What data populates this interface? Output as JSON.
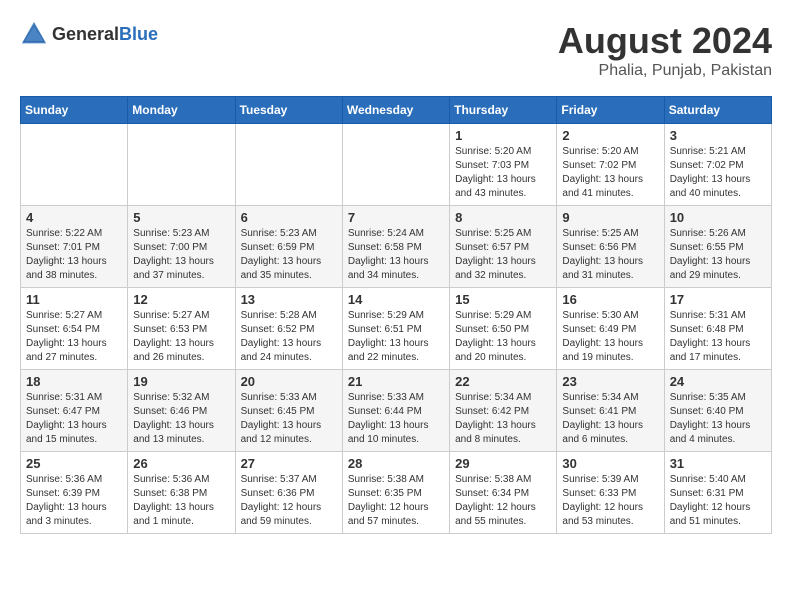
{
  "header": {
    "logo": {
      "general": "General",
      "blue": "Blue"
    },
    "title": "August 2024",
    "location": "Phalia, Punjab, Pakistan"
  },
  "calendar": {
    "weekdays": [
      "Sunday",
      "Monday",
      "Tuesday",
      "Wednesday",
      "Thursday",
      "Friday",
      "Saturday"
    ],
    "weeks": [
      [
        {
          "day": "",
          "info": ""
        },
        {
          "day": "",
          "info": ""
        },
        {
          "day": "",
          "info": ""
        },
        {
          "day": "",
          "info": ""
        },
        {
          "day": "1",
          "info": "Sunrise: 5:20 AM\nSunset: 7:03 PM\nDaylight: 13 hours\nand 43 minutes."
        },
        {
          "day": "2",
          "info": "Sunrise: 5:20 AM\nSunset: 7:02 PM\nDaylight: 13 hours\nand 41 minutes."
        },
        {
          "day": "3",
          "info": "Sunrise: 5:21 AM\nSunset: 7:02 PM\nDaylight: 13 hours\nand 40 minutes."
        }
      ],
      [
        {
          "day": "4",
          "info": "Sunrise: 5:22 AM\nSunset: 7:01 PM\nDaylight: 13 hours\nand 38 minutes."
        },
        {
          "day": "5",
          "info": "Sunrise: 5:23 AM\nSunset: 7:00 PM\nDaylight: 13 hours\nand 37 minutes."
        },
        {
          "day": "6",
          "info": "Sunrise: 5:23 AM\nSunset: 6:59 PM\nDaylight: 13 hours\nand 35 minutes."
        },
        {
          "day": "7",
          "info": "Sunrise: 5:24 AM\nSunset: 6:58 PM\nDaylight: 13 hours\nand 34 minutes."
        },
        {
          "day": "8",
          "info": "Sunrise: 5:25 AM\nSunset: 6:57 PM\nDaylight: 13 hours\nand 32 minutes."
        },
        {
          "day": "9",
          "info": "Sunrise: 5:25 AM\nSunset: 6:56 PM\nDaylight: 13 hours\nand 31 minutes."
        },
        {
          "day": "10",
          "info": "Sunrise: 5:26 AM\nSunset: 6:55 PM\nDaylight: 13 hours\nand 29 minutes."
        }
      ],
      [
        {
          "day": "11",
          "info": "Sunrise: 5:27 AM\nSunset: 6:54 PM\nDaylight: 13 hours\nand 27 minutes."
        },
        {
          "day": "12",
          "info": "Sunrise: 5:27 AM\nSunset: 6:53 PM\nDaylight: 13 hours\nand 26 minutes."
        },
        {
          "day": "13",
          "info": "Sunrise: 5:28 AM\nSunset: 6:52 PM\nDaylight: 13 hours\nand 24 minutes."
        },
        {
          "day": "14",
          "info": "Sunrise: 5:29 AM\nSunset: 6:51 PM\nDaylight: 13 hours\nand 22 minutes."
        },
        {
          "day": "15",
          "info": "Sunrise: 5:29 AM\nSunset: 6:50 PM\nDaylight: 13 hours\nand 20 minutes."
        },
        {
          "day": "16",
          "info": "Sunrise: 5:30 AM\nSunset: 6:49 PM\nDaylight: 13 hours\nand 19 minutes."
        },
        {
          "day": "17",
          "info": "Sunrise: 5:31 AM\nSunset: 6:48 PM\nDaylight: 13 hours\nand 17 minutes."
        }
      ],
      [
        {
          "day": "18",
          "info": "Sunrise: 5:31 AM\nSunset: 6:47 PM\nDaylight: 13 hours\nand 15 minutes."
        },
        {
          "day": "19",
          "info": "Sunrise: 5:32 AM\nSunset: 6:46 PM\nDaylight: 13 hours\nand 13 minutes."
        },
        {
          "day": "20",
          "info": "Sunrise: 5:33 AM\nSunset: 6:45 PM\nDaylight: 13 hours\nand 12 minutes."
        },
        {
          "day": "21",
          "info": "Sunrise: 5:33 AM\nSunset: 6:44 PM\nDaylight: 13 hours\nand 10 minutes."
        },
        {
          "day": "22",
          "info": "Sunrise: 5:34 AM\nSunset: 6:42 PM\nDaylight: 13 hours\nand 8 minutes."
        },
        {
          "day": "23",
          "info": "Sunrise: 5:34 AM\nSunset: 6:41 PM\nDaylight: 13 hours\nand 6 minutes."
        },
        {
          "day": "24",
          "info": "Sunrise: 5:35 AM\nSunset: 6:40 PM\nDaylight: 13 hours\nand 4 minutes."
        }
      ],
      [
        {
          "day": "25",
          "info": "Sunrise: 5:36 AM\nSunset: 6:39 PM\nDaylight: 13 hours\nand 3 minutes."
        },
        {
          "day": "26",
          "info": "Sunrise: 5:36 AM\nSunset: 6:38 PM\nDaylight: 13 hours\nand 1 minute."
        },
        {
          "day": "27",
          "info": "Sunrise: 5:37 AM\nSunset: 6:36 PM\nDaylight: 12 hours\nand 59 minutes."
        },
        {
          "day": "28",
          "info": "Sunrise: 5:38 AM\nSunset: 6:35 PM\nDaylight: 12 hours\nand 57 minutes."
        },
        {
          "day": "29",
          "info": "Sunrise: 5:38 AM\nSunset: 6:34 PM\nDaylight: 12 hours\nand 55 minutes."
        },
        {
          "day": "30",
          "info": "Sunrise: 5:39 AM\nSunset: 6:33 PM\nDaylight: 12 hours\nand 53 minutes."
        },
        {
          "day": "31",
          "info": "Sunrise: 5:40 AM\nSunset: 6:31 PM\nDaylight: 12 hours\nand 51 minutes."
        }
      ]
    ]
  }
}
